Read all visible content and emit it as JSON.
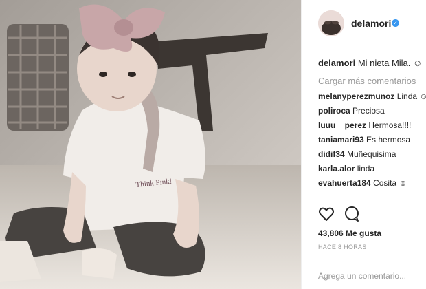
{
  "post": {
    "username": "delamori",
    "verified_icon": "verified-badge-icon",
    "caption_user": "delamori",
    "caption_text": "Mi nieta Mila. ☺",
    "load_more": "Cargar más comentarios",
    "comments": [
      {
        "user": "melanyperezmunoz",
        "text": "Linda ☺"
      },
      {
        "user": "poliroca",
        "text": "Preciosa"
      },
      {
        "user": "luuu__perez",
        "text": "Hermosa!!!!"
      },
      {
        "user": "taniamari93",
        "text": "Es hermosa"
      },
      {
        "user": "didif34",
        "text": "Muñequisima"
      },
      {
        "user": "karla.alor",
        "text": "linda"
      },
      {
        "user": "evahuerta184",
        "text": "Cosita ☺"
      }
    ],
    "likes": "43,806 Me gusta",
    "time": "HACE 8 HORAS",
    "add_comment_placeholder": "Agrega un comentario...",
    "photo_shirt_text": "Think Pink!",
    "accent_color": "#3897f0"
  }
}
